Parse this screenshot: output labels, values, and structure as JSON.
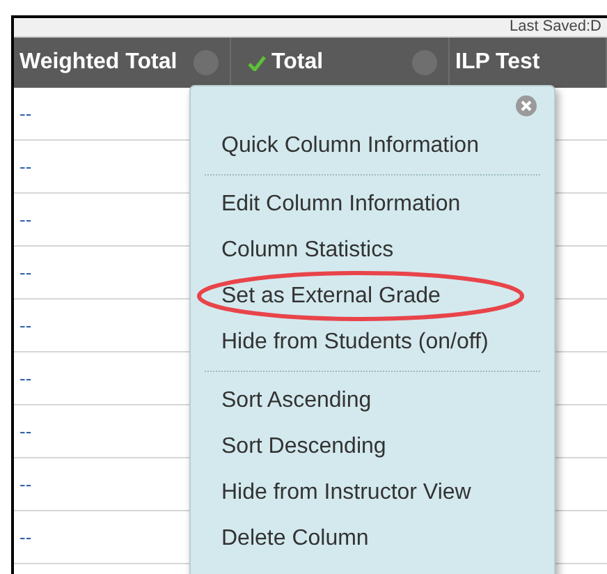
{
  "status": {
    "last_saved": "Last Saved:D"
  },
  "columns": [
    {
      "label": "Weighted Total",
      "checked": false,
      "menu_button": true
    },
    {
      "label": "Total",
      "checked": true,
      "menu_button": true
    },
    {
      "label": "ILP Test",
      "checked": false,
      "menu_button": false
    }
  ],
  "rows": [
    {
      "weighted_total": "--"
    },
    {
      "weighted_total": "--"
    },
    {
      "weighted_total": "--"
    },
    {
      "weighted_total": "--"
    },
    {
      "weighted_total": "--"
    },
    {
      "weighted_total": "--"
    },
    {
      "weighted_total": "--"
    },
    {
      "weighted_total": "--"
    },
    {
      "weighted_total": "--"
    }
  ],
  "menu": {
    "groups": [
      {
        "items": [
          {
            "label": "Quick Column Information",
            "circled": false
          }
        ]
      },
      {
        "items": [
          {
            "label": "Edit Column Information",
            "circled": false
          },
          {
            "label": "Column Statistics",
            "circled": false
          },
          {
            "label": "Set as External Grade",
            "circled": true
          },
          {
            "label": "Hide from Students (on/off)",
            "circled": false
          }
        ]
      },
      {
        "items": [
          {
            "label": "Sort Ascending",
            "circled": false
          },
          {
            "label": "Sort Descending",
            "circled": false
          },
          {
            "label": "Hide from Instructor View",
            "circled": false
          },
          {
            "label": "Delete Column",
            "circled": false
          }
        ]
      }
    ]
  }
}
